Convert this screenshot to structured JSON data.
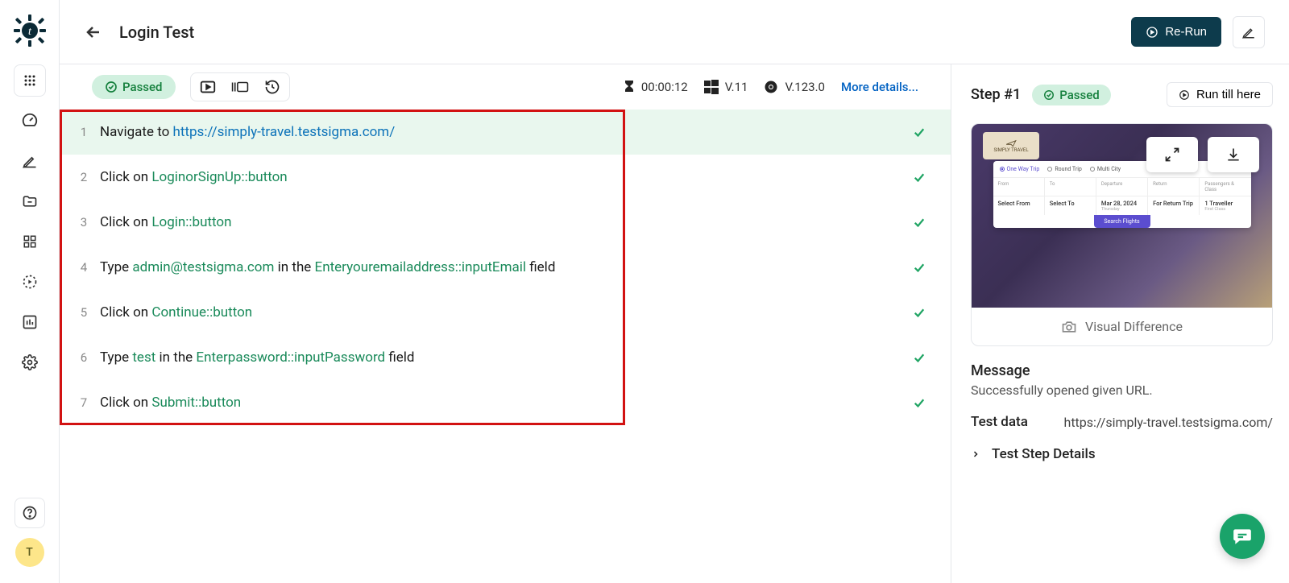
{
  "sidebar": {
    "avatar_letter": "T"
  },
  "header": {
    "title": "Login Test",
    "rerun_label": "Re-Run"
  },
  "toolbar": {
    "status": "Passed",
    "duration": "00:00:12",
    "os_version": "V.11",
    "browser_version": "V.123.0",
    "more_details": "More details..."
  },
  "steps": [
    {
      "num": "1",
      "parts": [
        {
          "t": "Navigate to ",
          "c": "plain"
        },
        {
          "t": "https://simply-travel.testsigma.com/",
          "c": "link"
        }
      ],
      "active": true
    },
    {
      "num": "2",
      "parts": [
        {
          "t": "Click on ",
          "c": "plain"
        },
        {
          "t": "LoginorSignUp::button",
          "c": "elem"
        }
      ]
    },
    {
      "num": "3",
      "parts": [
        {
          "t": "Click on ",
          "c": "plain"
        },
        {
          "t": "Login::button",
          "c": "elem"
        }
      ]
    },
    {
      "num": "4",
      "parts": [
        {
          "t": "Type ",
          "c": "plain"
        },
        {
          "t": "admin@testsigma.com",
          "c": "elem"
        },
        {
          "t": " in the ",
          "c": "plain"
        },
        {
          "t": "Enteryouremailaddress::inputEmail",
          "c": "elem"
        },
        {
          "t": " field",
          "c": "plain"
        }
      ]
    },
    {
      "num": "5",
      "parts": [
        {
          "t": "Click on ",
          "c": "plain"
        },
        {
          "t": "Continue::button",
          "c": "elem"
        }
      ]
    },
    {
      "num": "6",
      "parts": [
        {
          "t": "Type ",
          "c": "plain"
        },
        {
          "t": "test",
          "c": "elem"
        },
        {
          "t": " in the ",
          "c": "plain"
        },
        {
          "t": "Enterpassword::inputPassword",
          "c": "elem"
        },
        {
          "t": " field",
          "c": "plain"
        }
      ]
    },
    {
      "num": "7",
      "parts": [
        {
          "t": "Click on ",
          "c": "plain"
        },
        {
          "t": "Submit::button",
          "c": "elem"
        }
      ]
    }
  ],
  "detail": {
    "step_label": "Step #1",
    "status": "Passed",
    "run_till": "Run till here",
    "visual_diff": "Visual Difference",
    "message_title": "Message",
    "message_body": "Successfully opened given URL.",
    "test_data_label": "Test data",
    "test_data_value": "https://simply-travel.testsigma.com/",
    "details_toggle": "Test Step Details",
    "screenshot": {
      "brand": "SIMPLY TRAVEL",
      "trip_options": [
        "One Way Trip",
        "Round Trip",
        "Multi City"
      ],
      "fields": {
        "from_label": "From",
        "from_value": "Select From",
        "to_label": "To",
        "to_value": "Select To",
        "departure_label": "Departure",
        "departure_value": "Mar 28, 2024",
        "departure_sub": "Thursday",
        "return_label": "Return",
        "return_value": "For Return Trip",
        "passengers_label": "Passengers & Class",
        "passengers_value": "1 Traveller",
        "passengers_sub": "First Class"
      },
      "search_btn": "Search Flights"
    }
  }
}
